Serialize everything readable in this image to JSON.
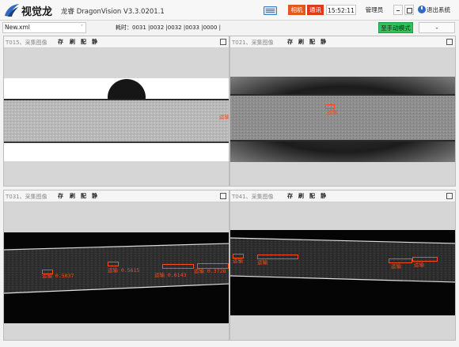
{
  "titlebar": {
    "brand": "视觉龙",
    "app_title": "龙睿 DragonVision V3.3.0201.1",
    "camera_badge": "相机",
    "comm_badge": "通讯",
    "clock": "15:52:11",
    "user": "管理员",
    "exit_label": "退出系统"
  },
  "toolbar": {
    "file": "New.xml",
    "timing": "耗时：0031  |0032  |0032  |0033  |0000  |",
    "mode_button": "至手动模式",
    "dash_button": "-"
  },
  "panels": [
    {
      "title": "T015、采集图像",
      "buttons": [
        "存",
        "刷",
        "配",
        "静"
      ],
      "labels": [
        "运输"
      ]
    },
    {
      "title": "T021、采集图像",
      "buttons": [
        "存",
        "刷",
        "配",
        "静"
      ],
      "labels": [
        "运输"
      ]
    },
    {
      "title": "T031、采集图像",
      "buttons": [
        "存",
        "刷",
        "配",
        "静"
      ],
      "labels": [
        "运输 0.5037",
        "运输 0.5615",
        "运输 0.6143",
        "运输 0.3728"
      ]
    },
    {
      "title": "T041、采集图像",
      "buttons": [
        "存",
        "刷",
        "配",
        "静"
      ],
      "labels": [
        "运输",
        "运输",
        "运输",
        "运输"
      ]
    }
  ],
  "colors": {
    "mode_green": "#2ec35b",
    "camera_orange": "#e2591b",
    "comm_red": "#e03a1d",
    "detection": "#ff4a1a",
    "brand_blue": "#2f6cc0"
  },
  "icons": [
    "logo-icon",
    "keyboard-icon",
    "minimize-icon",
    "maximize-icon",
    "power-icon",
    "maximize-panel-icon",
    "dropdown-chevron-icon"
  ]
}
